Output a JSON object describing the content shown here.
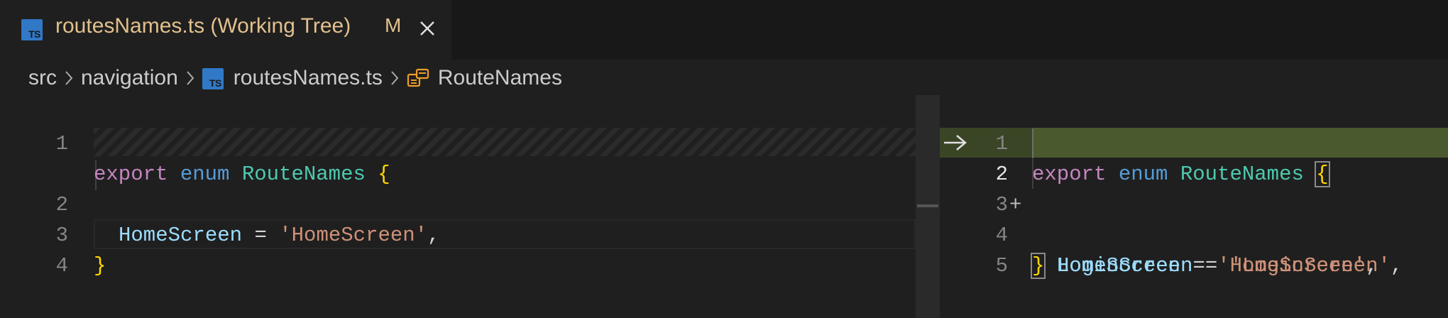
{
  "tab": {
    "icon_text": "TS",
    "title": "routesNames.ts (Working Tree)",
    "modified": "M"
  },
  "breadcrumb": {
    "items": [
      "src",
      "navigation",
      "routesNames.ts",
      "RouteNames"
    ],
    "file_icon_text": "TS"
  },
  "left_editor": {
    "lines": [
      {
        "number": "1",
        "tokens": [
          "export",
          "enum",
          "RouteNames",
          "{"
        ]
      },
      {
        "number": "2",
        "tokens": [
          "HomeScreen",
          "=",
          "'HomeScreen'",
          ","
        ]
      },
      {
        "number": "3",
        "tokens": [
          "}"
        ]
      },
      {
        "number": "4",
        "tokens": []
      }
    ]
  },
  "right_editor": {
    "lines": [
      {
        "number": "1",
        "tokens": [
          "export",
          "enum",
          "RouteNames",
          "{"
        ]
      },
      {
        "number": "2",
        "marker": "+",
        "tokens": [
          "LoginScreen",
          "=",
          "'LoginScreen'",
          ","
        ]
      },
      {
        "number": "3",
        "tokens": [
          "HomeScreen",
          "=",
          "'HomeScreen'",
          ","
        ]
      },
      {
        "number": "4",
        "tokens": [
          "}"
        ]
      },
      {
        "number": "5",
        "tokens": []
      }
    ]
  },
  "colors": {
    "keyword": "#c586c0",
    "storage": "#569cd6",
    "type": "#4ec9b0",
    "brace": "#ffd700",
    "property": "#9cdcfe",
    "string": "#ce9178",
    "added_line_bg": "#4b5a2e",
    "ts_icon": "#3178c6"
  }
}
